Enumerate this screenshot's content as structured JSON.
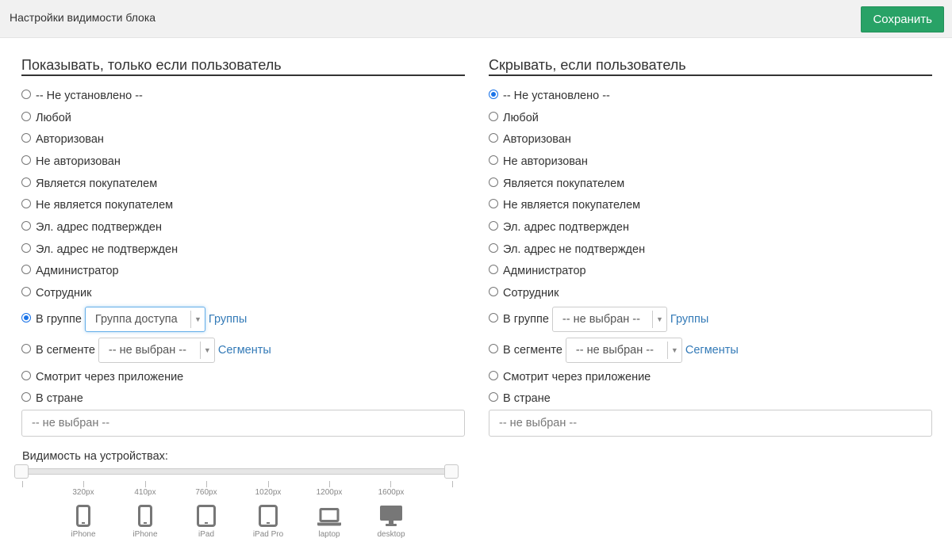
{
  "header": {
    "title": "Настройки видимости блока",
    "save_label": "Сохранить"
  },
  "show": {
    "heading": "Показывать, только если пользователь",
    "options": [
      {
        "label": "-- Не установлено --",
        "checked": false
      },
      {
        "label": "Любой",
        "checked": false
      },
      {
        "label": "Авторизован",
        "checked": false
      },
      {
        "label": "Не авторизован",
        "checked": false
      },
      {
        "label": "Является покупателем",
        "checked": false
      },
      {
        "label": "Не является покупателем",
        "checked": false
      },
      {
        "label": "Эл. адрес подтвержден",
        "checked": false
      },
      {
        "label": "Эл. адрес не подтвержден",
        "checked": false
      },
      {
        "label": "Администратор",
        "checked": false
      },
      {
        "label": "Сотрудник",
        "checked": false
      }
    ],
    "group": {
      "label": "В группе",
      "checked": true,
      "select_value": "Группа доступа",
      "link": "Группы"
    },
    "segment": {
      "label": "В сегменте",
      "checked": false,
      "select_value": "-- не выбран --",
      "link": "Сегменты"
    },
    "app": {
      "label": "Смотрит через приложение",
      "checked": false
    },
    "country": {
      "label": "В стране",
      "checked": false,
      "placeholder": "-- не выбран --"
    }
  },
  "hide": {
    "heading": "Скрывать, если пользователь",
    "options": [
      {
        "label": "-- Не установлено --",
        "checked": true
      },
      {
        "label": "Любой",
        "checked": false
      },
      {
        "label": "Авторизован",
        "checked": false
      },
      {
        "label": "Не авторизован",
        "checked": false
      },
      {
        "label": "Является покупателем",
        "checked": false
      },
      {
        "label": "Не является покупателем",
        "checked": false
      },
      {
        "label": "Эл. адрес подтвержден",
        "checked": false
      },
      {
        "label": "Эл. адрес не подтвержден",
        "checked": false
      },
      {
        "label": "Администратор",
        "checked": false
      },
      {
        "label": "Сотрудник",
        "checked": false
      }
    ],
    "group": {
      "label": "В группе",
      "checked": false,
      "select_value": "-- не выбран --",
      "link": "Группы"
    },
    "segment": {
      "label": "В сегменте",
      "checked": false,
      "select_value": "-- не выбран --",
      "link": "Сегменты"
    },
    "app": {
      "label": "Смотрит через приложение",
      "checked": false
    },
    "country": {
      "label": "В стране",
      "checked": false,
      "placeholder": "-- не выбран --"
    }
  },
  "devices": {
    "label": "Видимость на устройствах:",
    "items": [
      {
        "px": "320px",
        "name": "iPhone",
        "icon": "phone-icon"
      },
      {
        "px": "410px",
        "name": "iPhone",
        "icon": "phone-icon"
      },
      {
        "px": "760px",
        "name": "iPad",
        "icon": "tablet-icon"
      },
      {
        "px": "1020px",
        "name": "iPad Pro",
        "icon": "tablet-icon"
      },
      {
        "px": "1200px",
        "name": "laptop",
        "icon": "laptop-icon"
      },
      {
        "px": "1600px",
        "name": "desktop",
        "icon": "desktop-icon"
      }
    ]
  }
}
